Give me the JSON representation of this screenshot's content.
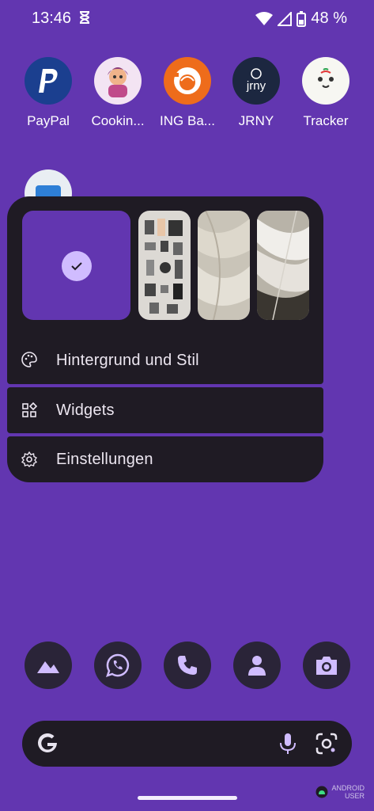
{
  "status_bar": {
    "time": "13:46",
    "battery": "48 %",
    "icons": [
      "hourglass-icon",
      "wifi-icon",
      "cell-signal-icon",
      "battery-icon"
    ]
  },
  "apps": [
    {
      "label": "PayPal",
      "icon": "paypal-icon",
      "color": "#1b3f8f"
    },
    {
      "label": "Cookin...",
      "icon": "cooking-game-icon",
      "color": "#f3e4f3"
    },
    {
      "label": "ING Ba...",
      "icon": "ing-lion-icon",
      "color": "#ee6c1b"
    },
    {
      "label": "JRNY",
      "icon": "jrny-icon",
      "color": "#1c2740"
    },
    {
      "label": "Tracker",
      "icon": "tracker-dog-icon",
      "color": "#f7f7f2"
    }
  ],
  "popup": {
    "wallpapers": [
      "current-wallpaper-selected",
      "phone-parts-wallpaper",
      "white-texture-wallpaper",
      "feathers-wallpaper"
    ],
    "menu": [
      {
        "label": "Hintergrund und Stil",
        "icon": "palette-icon"
      },
      {
        "label": "Widgets",
        "icon": "widgets-icon"
      },
      {
        "label": "Einstellungen",
        "icon": "settings-gear-icon"
      }
    ]
  },
  "dock": [
    "gallery-icon",
    "whatsapp-icon",
    "phone-icon",
    "contacts-icon",
    "camera-icon"
  ],
  "search": {
    "logo": "google-g-icon",
    "mic": "mic-icon",
    "lens": "lens-icon"
  },
  "watermark": {
    "line1": "ANDROID",
    "line2": "USER"
  },
  "colors": {
    "background": "#6236b0",
    "surface": "#1f1b24",
    "accent": "#d0bcff"
  }
}
